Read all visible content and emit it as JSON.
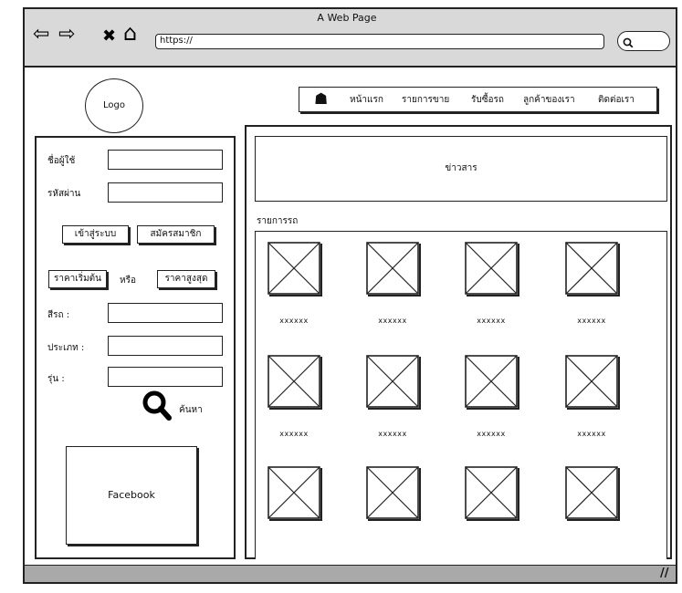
{
  "window": {
    "title": "A Web Page",
    "url": "https://",
    "nav_buttons": [
      {
        "name": "back-icon",
        "glyph": "⇦"
      },
      {
        "name": "forward-icon",
        "glyph": "⇨"
      },
      {
        "name": "close-icon",
        "glyph": "✖"
      },
      {
        "name": "home-icon",
        "glyph": "⌂"
      }
    ]
  },
  "logo": "Logo",
  "nav": {
    "home_icon": "☗",
    "items": [
      "หน้าแรก",
      "รายการขาย",
      "รับซื้อรถ",
      "ลูกค้าของเรา",
      "ติดต่อเรา"
    ]
  },
  "login": {
    "username_label": "ชื่อผู้ใช้",
    "password_label": "รหัสผ่าน",
    "login_button": "เข้าสู่ระบบ",
    "register_button": "สมัครสมาชิก"
  },
  "search": {
    "min_price_button": "ราคาเริ่มต้น",
    "or_label": "หรือ",
    "max_price_button": "ราคาสูงสุด",
    "color_label": "สีรถ :",
    "type_label": "ประเภท :",
    "model_label": "รุ่น :",
    "search_label": "ค้นหา"
  },
  "facebook": "Facebook",
  "news": "ข่าวสาร",
  "cars": {
    "title": "รายการรถ",
    "rows": [
      [
        "xxxxxx",
        "xxxxxx",
        "xxxxxx",
        "xxxxxx"
      ],
      [
        "xxxxxx",
        "xxxxxx",
        "xxxxxx",
        "xxxxxx"
      ],
      [
        "",
        "",
        "",
        ""
      ]
    ]
  }
}
